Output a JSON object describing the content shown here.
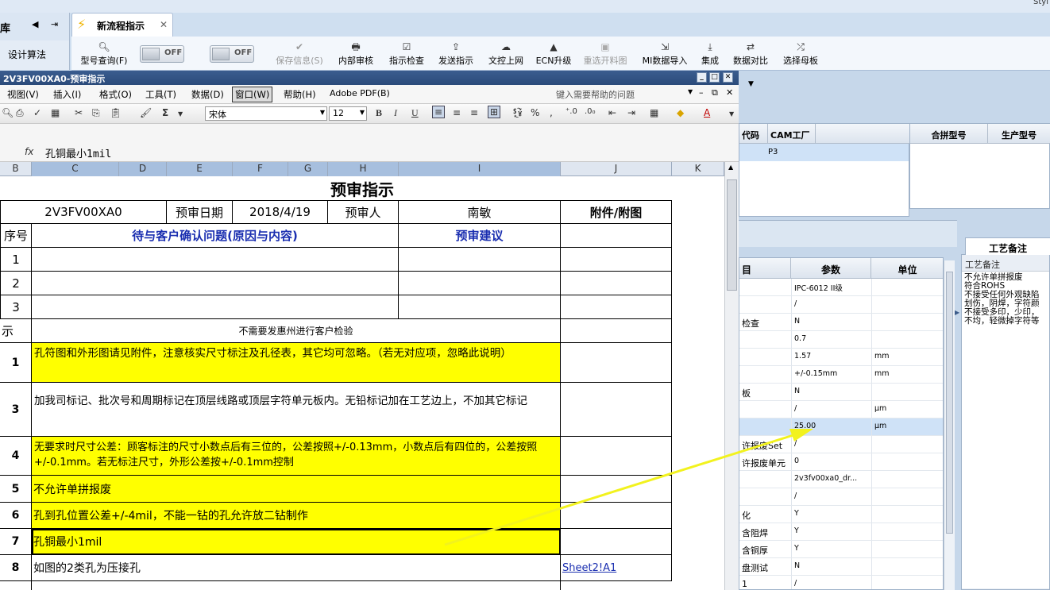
{
  "app": {
    "corner_text": "Styl"
  },
  "left_panel": {
    "title": "库",
    "algo_button": "设计算法"
  },
  "tab": {
    "label": "新流程指示"
  },
  "ribbon": {
    "items": [
      {
        "label": "型号查询(F)",
        "icon": "search-icon"
      },
      {
        "label": "保存信息(S)",
        "icon": "check-icon",
        "disabled": true
      },
      {
        "label": "内部审核",
        "icon": "print-icon"
      },
      {
        "label": "指示检查",
        "icon": "checklist-icon"
      },
      {
        "label": "发送指示",
        "icon": "upload-icon"
      },
      {
        "label": "文控上网",
        "icon": "cloud-upload-icon"
      },
      {
        "label": "ECN升级",
        "icon": "ecn-icon"
      },
      {
        "label": "重选开料图",
        "icon": "image-icon",
        "disabled": true
      },
      {
        "label": "MI数据导入",
        "icon": "import-icon"
      },
      {
        "label": "集成",
        "icon": "download-icon"
      },
      {
        "label": "数据对比",
        "icon": "compare-icon"
      },
      {
        "label": "选择母板",
        "icon": "shuffle-icon"
      }
    ],
    "toggle1": "OFF",
    "toggle2": "OFF"
  },
  "excel": {
    "window_title": "2V3FV00XA0-预审指示",
    "menu": [
      "视图(V)",
      "插入(I)",
      "格式(O)",
      "工具(T)",
      "数据(D)",
      "窗口(W)",
      "帮助(H)",
      "Adobe PDF(B)"
    ],
    "help_placeholder": "键入需要帮助的问题",
    "font_name": "宋体",
    "font_size": "12",
    "formula_text": "孔铜最小1mil",
    "columns": [
      "B",
      "C",
      "D",
      "E",
      "F",
      "G",
      "H",
      "I",
      "J",
      "K"
    ],
    "sheet": {
      "title": "预审指示",
      "part_no": "2V3FV00XA0",
      "date_label": "预审日期",
      "date": "2018/4/19",
      "reviewer_label": "预审人",
      "reviewer": "南敏",
      "attach_label": "附件/附图",
      "seq_label": "序号",
      "issue_label": "待与客户确认问题(原因与内容)",
      "advice_label": "预审建议",
      "issue_rows": [
        "1",
        "2",
        "3"
      ],
      "section_label": "示",
      "section_note": "不需要发惠州进行客户检验",
      "instructions": [
        {
          "no": "1",
          "text": "孔符图和外形图请见附件，注意核实尺寸标注及孔径表，其它均可忽略。（若无对应项，忽略此说明）",
          "highlight": true
        },
        {
          "no": "3",
          "text": "加我司标记、批次号和周期标记在顶层线路或顶层字符单元板内。无铅标记加在工艺边上，不加其它标记",
          "highlight": false
        },
        {
          "no": "4",
          "text": "无要求时尺寸公差：顾客标注的尺寸小数点后有三位的，公差按照+/-0.13mm，小数点后有四位的，公差按照+/-0.1mm。若无标注尺寸，外形公差按+/-0.1mm控制",
          "highlight": true
        },
        {
          "no": "5",
          "text": "不允许单拼报废",
          "highlight": true
        },
        {
          "no": "6",
          "text": "孔到孔位置公差+/-4mil，不能一钻的孔允许放二钻制作",
          "highlight": true
        },
        {
          "no": "7",
          "text": "孔铜最小1mil",
          "highlight": true
        },
        {
          "no": "8",
          "text": "如图的2类孔为压接孔",
          "highlight": false,
          "link": "Sheet2!A1"
        }
      ]
    }
  },
  "right": {
    "grid_headers": [
      "代码",
      "CAM工厂",
      "合拼型号",
      "生产型号"
    ],
    "grid_row": [
      "",
      "P3"
    ],
    "notes_tab": "工艺备注",
    "notes_title": "工艺备注",
    "notes_lines": [
      "不允许单拼报废",
      "符合ROHS",
      "不接受任何外观缺陷",
      "划伤，阴焊，字符颜",
      "不接受多印，少印，",
      "不均，轻微掉字符等"
    ],
    "param_headers": [
      "目",
      "参数",
      "单位"
    ],
    "params": [
      [
        "",
        "IPC-6012 II级",
        ""
      ],
      [
        "",
        "/",
        ""
      ],
      [
        "检查",
        "N",
        ""
      ],
      [
        "",
        "0.7",
        ""
      ],
      [
        "",
        "1.57",
        "mm"
      ],
      [
        "",
        "+/-0.15mm",
        "mm"
      ],
      [
        "板",
        "N",
        ""
      ],
      [
        "",
        "/",
        "μm"
      ],
      [
        "",
        "25.00",
        "μm"
      ],
      [
        "许报废Set",
        "/",
        ""
      ],
      [
        "许报废单元",
        "0",
        ""
      ],
      [
        "",
        "2v3fv00xa0_dr...",
        ""
      ],
      [
        "",
        "/",
        ""
      ],
      [
        "化",
        "Y",
        ""
      ],
      [
        "含阻焊",
        "Y",
        ""
      ],
      [
        "含铜厚",
        "Y",
        ""
      ],
      [
        "盘测试",
        "N",
        ""
      ],
      [
        "1",
        "/",
        ""
      ]
    ]
  }
}
